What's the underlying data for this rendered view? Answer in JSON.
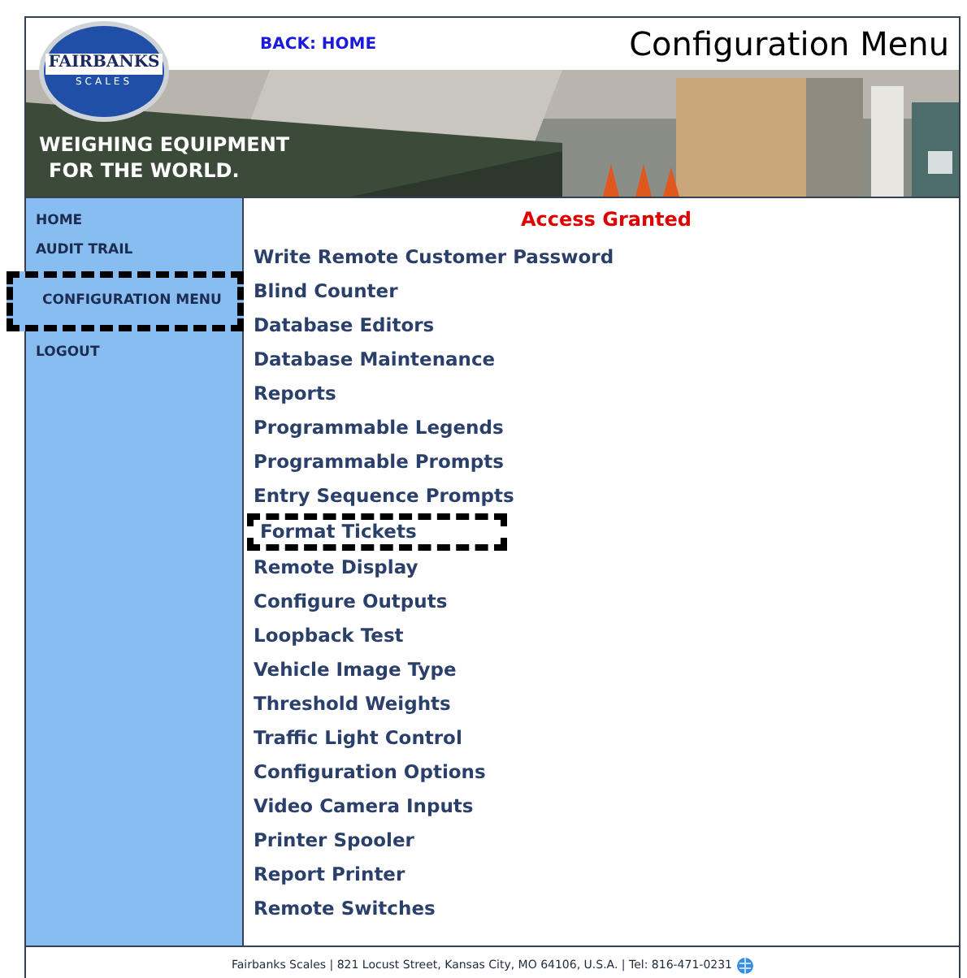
{
  "header": {
    "back_link": "BACK: HOME",
    "title": "Configuration Menu",
    "logo": {
      "name": "FAIRBANKS",
      "sub": "SCALES"
    },
    "tagline": [
      "WEIGHING EQUIPMENT",
      "FOR THE WORLD."
    ]
  },
  "sidebar": {
    "items": [
      {
        "label": "HOME",
        "highlighted": false
      },
      {
        "label": "AUDIT TRAIL",
        "highlighted": false
      },
      {
        "label": "CONFIGURATION MENU",
        "highlighted": true
      },
      {
        "label": "LOGOUT",
        "highlighted": false
      }
    ]
  },
  "main": {
    "status": "Access Granted",
    "items": [
      {
        "label": "Write Remote Customer Password",
        "highlighted": false
      },
      {
        "label": "Blind Counter",
        "highlighted": false
      },
      {
        "label": "Database Editors",
        "highlighted": false
      },
      {
        "label": "Database Maintenance",
        "highlighted": false
      },
      {
        "label": "Reports",
        "highlighted": false
      },
      {
        "label": "Programmable Legends",
        "highlighted": false
      },
      {
        "label": "Programmable Prompts",
        "highlighted": false
      },
      {
        "label": "Entry Sequence Prompts",
        "highlighted": false
      },
      {
        "label": "Format Tickets",
        "highlighted": true
      },
      {
        "label": "Remote Display",
        "highlighted": false
      },
      {
        "label": "Configure Outputs",
        "highlighted": false
      },
      {
        "label": "Loopback Test",
        "highlighted": false
      },
      {
        "label": "Vehicle Image Type",
        "highlighted": false
      },
      {
        "label": "Threshold Weights",
        "highlighted": false
      },
      {
        "label": "Traffic Light Control",
        "highlighted": false
      },
      {
        "label": "Configuration Options",
        "highlighted": false
      },
      {
        "label": "Video Camera Inputs",
        "highlighted": false
      },
      {
        "label": "Printer Spooler",
        "highlighted": false
      },
      {
        "label": "Report Printer",
        "highlighted": false
      },
      {
        "label": "Remote Switches",
        "highlighted": false
      }
    ]
  },
  "footer": {
    "text": "Fairbanks Scales | 821 Locust Street, Kansas City, MO 64106, U.S.A. | Tel: 816-471-0231"
  }
}
